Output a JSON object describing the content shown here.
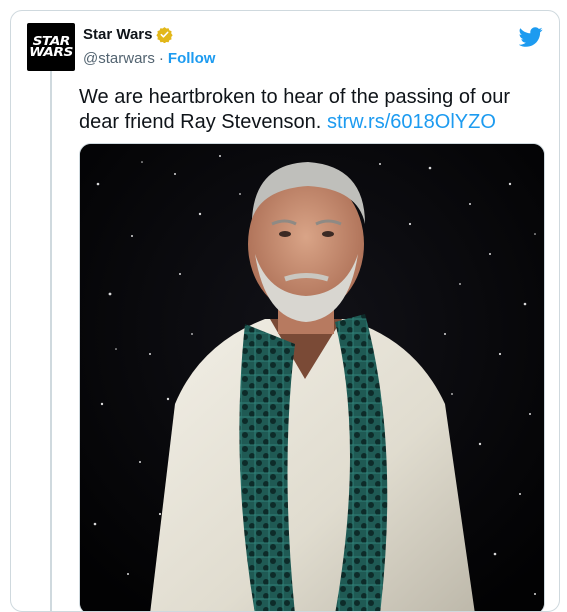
{
  "tweet": {
    "display_name": "Star Wars",
    "handle": "@starwars",
    "separator": "·",
    "follow_label": "Follow",
    "logo_line1": "STAR",
    "logo_line2": "WARS",
    "text": "We are heartbroken to hear of the passing of our dear friend Ray Stevenson.",
    "link_text": "strw.rs/6018OlYZO"
  },
  "colors": {
    "accent": "#1d9bf0",
    "verified_badge": "#e2b719",
    "text_primary": "#0f1419",
    "text_secondary": "#536471",
    "border": "#cfd9de"
  },
  "icons": {
    "verified": "verified-badge-icon",
    "brand": "twitter-bird-icon"
  }
}
